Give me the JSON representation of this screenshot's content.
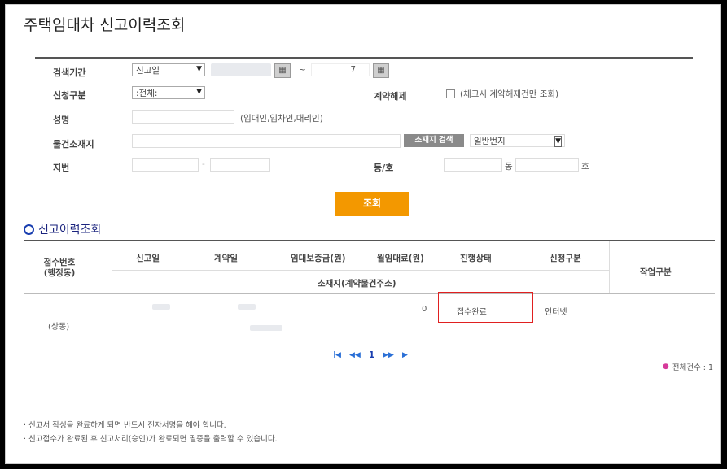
{
  "page": {
    "title": "주택임대차 신고이력조회"
  },
  "form": {
    "period_label": "검색기간",
    "period_type": "신고일",
    "date_sep": "~",
    "date_end_fragment": "7",
    "apply_label": "신청구분",
    "apply_value": ":전체:",
    "cancel_label": "계약해제",
    "cancel_desc": "(체크시 계약해제건만 조회)",
    "name_label": "성명",
    "name_hint": "(임대인,임차인,대리인)",
    "address_label": "물건소재지",
    "address_search_button": "소재지 검색",
    "lot_type": "일반번지",
    "jibun_label": "지번",
    "jibun_sep": "-",
    "dongho_label": "동/호",
    "dong_suffix": "동",
    "ho_suffix": "호",
    "query_button": "조회"
  },
  "section": {
    "title": "신고이력조회"
  },
  "table": {
    "headers": {
      "receipt_no": "접수번호\n(행정동)",
      "report_date": "신고일",
      "contract_date": "계약일",
      "deposit": "임대보증금(원)",
      "monthly_rent": "월임대료(원)",
      "status": "진행상태",
      "apply_type": "신청구분",
      "work_type": "작업구분",
      "address": "소재지(계약물건주소)"
    },
    "row": {
      "monthly_rent": "0",
      "status": "접수완료",
      "apply_type": "인터넷",
      "admin_dong": "(상동)"
    }
  },
  "pager": {
    "first": "|◀",
    "prev": "◀◀",
    "page": "1",
    "next": "▶▶",
    "last": "▶|"
  },
  "total": {
    "label": "전체건수 : 1"
  },
  "notes": [
    "신고서 작성을 완료하게 되면 반드시 전자서명을 해야 합니다.",
    "신고접수가 완료된 후 신고처리(승인)가 완료되면 필증을 출력할 수 있습니다."
  ],
  "colors": {
    "accent": "#f39800",
    "highlight": "#e02020",
    "section": "#1a237e"
  }
}
